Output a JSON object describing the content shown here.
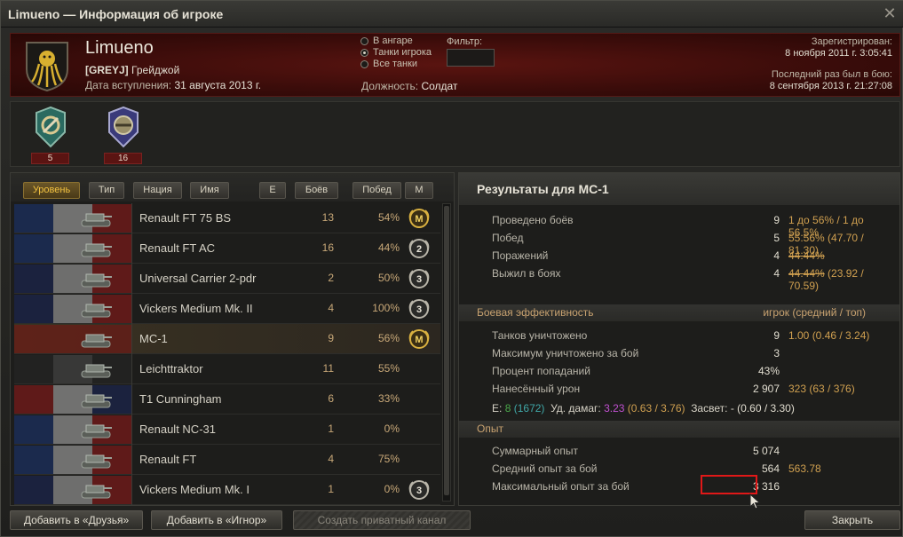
{
  "window": {
    "title": "Limueno — Информация об игроке"
  },
  "header": {
    "player_name": "Limueno",
    "clan_tag": "[GREYJ]",
    "clan_name": "Грейджой",
    "join_label": "Дата вступления:",
    "join_date": "31 августа 2013 г.",
    "radio_options": [
      {
        "label": "В ангаре",
        "selected": false
      },
      {
        "label": "Танки игрока",
        "selected": true
      },
      {
        "label": "Все танки",
        "selected": false
      }
    ],
    "filter_label": "Фильтр:",
    "filter_value": "",
    "role_label": "Должность:",
    "role_value": "Солдат",
    "registered_label": "Зарегистрирован:",
    "registered_value": "8 ноября 2011 г. 3:05:41",
    "last_battle_label": "Последний раз был в бою:",
    "last_battle_value": "8 сентября 2013 г. 21:27:08"
  },
  "medals": [
    {
      "icon": "medal-green-icon",
      "count": "5"
    },
    {
      "icon": "medal-blue-icon",
      "count": "16"
    }
  ],
  "sort_buttons": [
    "Уровень",
    "Тип",
    "Нация",
    "Имя",
    "E",
    "Боёв",
    "Побед",
    "М"
  ],
  "tanks": [
    {
      "nation": "france",
      "name": "Renault FT 75 BS",
      "battles": "13",
      "wins": "54%",
      "mastery": "М"
    },
    {
      "nation": "france",
      "name": "Renault FT AC",
      "battles": "16",
      "wins": "44%",
      "mastery": "2"
    },
    {
      "nation": "uk",
      "name": "Universal Carrier 2-pdr",
      "battles": "2",
      "wins": "50%",
      "mastery": "3"
    },
    {
      "nation": "uk",
      "name": "Vickers Medium Mk. II",
      "battles": "4",
      "wins": "100%",
      "mastery": "3"
    },
    {
      "nation": "ussr",
      "name": "MC-1",
      "battles": "9",
      "wins": "56%",
      "mastery": "М"
    },
    {
      "nation": "germany",
      "name": "Leichttraktor",
      "battles": "11",
      "wins": "55%",
      "mastery": ""
    },
    {
      "nation": "usa",
      "name": "T1 Cunningham",
      "battles": "6",
      "wins": "33%",
      "mastery": ""
    },
    {
      "nation": "france",
      "name": "Renault NC-31",
      "battles": "1",
      "wins": "0%",
      "mastery": ""
    },
    {
      "nation": "france",
      "name": "Renault FT",
      "battles": "4",
      "wins": "75%",
      "mastery": ""
    },
    {
      "nation": "uk",
      "name": "Vickers Medium Mk. I",
      "battles": "1",
      "wins": "0%",
      "mastery": "3"
    }
  ],
  "results": {
    "title": "Результаты для МС-1",
    "general": [
      {
        "label": "Проведено боёв",
        "value": "9",
        "extra": "1 до 56% / 1 до 56.5%"
      },
      {
        "label": "Побед",
        "value": "5",
        "extra": "55.56% (47.70 / 81.30)"
      },
      {
        "label": "Поражений",
        "value": "4",
        "extra": "44.44%"
      },
      {
        "label": "Выжил в боях",
        "value": "4",
        "extra_strike": "44.44%",
        "extra": " (23.92 / 70.59)"
      }
    ],
    "efficiency_head": "Боевая эффективность",
    "efficiency_head_right": "игрок (средний / топ)",
    "efficiency": [
      {
        "label": "Танков уничтожено",
        "value": "9",
        "extra": "1.00 (0.46 / 3.24)"
      },
      {
        "label": "Максимум уничтожено за бой",
        "value": "3",
        "extra": ""
      },
      {
        "label": "Процент попаданий",
        "value": "43%",
        "extra": ""
      },
      {
        "label": "Нанесённый урон",
        "value": "2 907",
        "extra": "323 (63 / 376)"
      }
    ],
    "eff_line": {
      "e_label": "Е:",
      "e_value": "8",
      "e_paren": "(1672)",
      "dmg_label": "Уд. дамаг:",
      "dmg_value": "3.23",
      "dmg_paren": "(0.63 / 3.76)",
      "spot_label": "Засвет:",
      "spot_value": "- (0.60 / 3.30)"
    },
    "exp_head": "Опыт",
    "experience": [
      {
        "label": "Суммарный опыт",
        "value": "5 074",
        "extra": ""
      },
      {
        "label": "Средний опыт за бой",
        "value": "564",
        "extra": "563.78"
      },
      {
        "label": "Максимальный опыт за бой",
        "value": "3 316",
        "extra": ""
      }
    ]
  },
  "buttons": {
    "add_friends": "Добавить в «Друзья»",
    "add_ignore": "Добавить в «Игнор»",
    "private_channel": "Создать приватный канал",
    "close": "Закрыть"
  },
  "colors": {
    "accent_gold": "#d0a050",
    "header_red": "#5a1410",
    "highlight_red": "#e01818"
  }
}
